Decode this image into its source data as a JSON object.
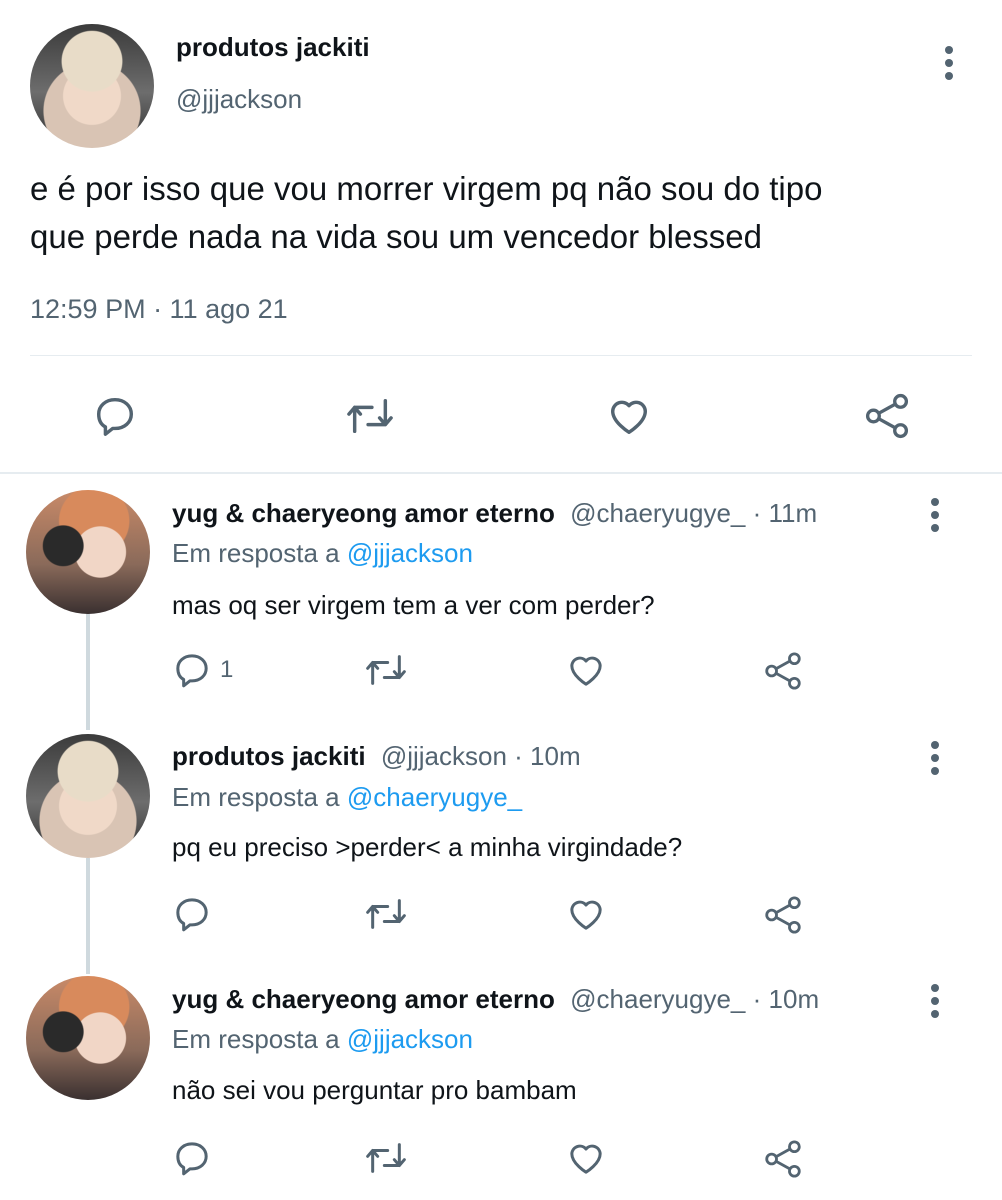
{
  "main_tweet": {
    "display_name": "produtos jackiti",
    "handle": "@jjjackson",
    "text_line1": "e é por isso que vou morrer virgem pq não sou do tipo",
    "text_line2": "que perde nada na vida sou um vencedor blessed",
    "timestamp": "12:59 PM · 11 ago 21"
  },
  "replies": [
    {
      "display_name": "yug & chaeryeong amor eterno",
      "handle": "@chaeryugye_",
      "time": "· 11m",
      "replying_prefix": "Em resposta a",
      "replying_to": "@jjjackson",
      "text": "mas oq ser virgem tem a ver com perder?",
      "reply_count": "1"
    },
    {
      "display_name": "produtos jackiti",
      "handle": "@jjjackson",
      "time": "· 10m",
      "replying_prefix": "Em resposta a",
      "replying_to": "@chaeryugye_",
      "text": "pq eu preciso >perder< a minha virgindade?",
      "reply_count": ""
    },
    {
      "display_name": "yug & chaeryeong amor eterno",
      "handle": "@chaeryugye_",
      "time": "· 10m",
      "replying_prefix": "Em resposta a",
      "replying_to": "@jjjackson",
      "text": "não sei vou perguntar pro bambam",
      "reply_count": ""
    }
  ],
  "icons": {
    "reply": "reply-icon",
    "retweet": "retweet-icon",
    "like": "heart-icon",
    "share": "share-icon",
    "more": "more-options-icon"
  },
  "colors": {
    "text": "#0f1419",
    "secondary": "#536471",
    "link": "#1d9bf0",
    "divider": "#e6ecf0"
  }
}
